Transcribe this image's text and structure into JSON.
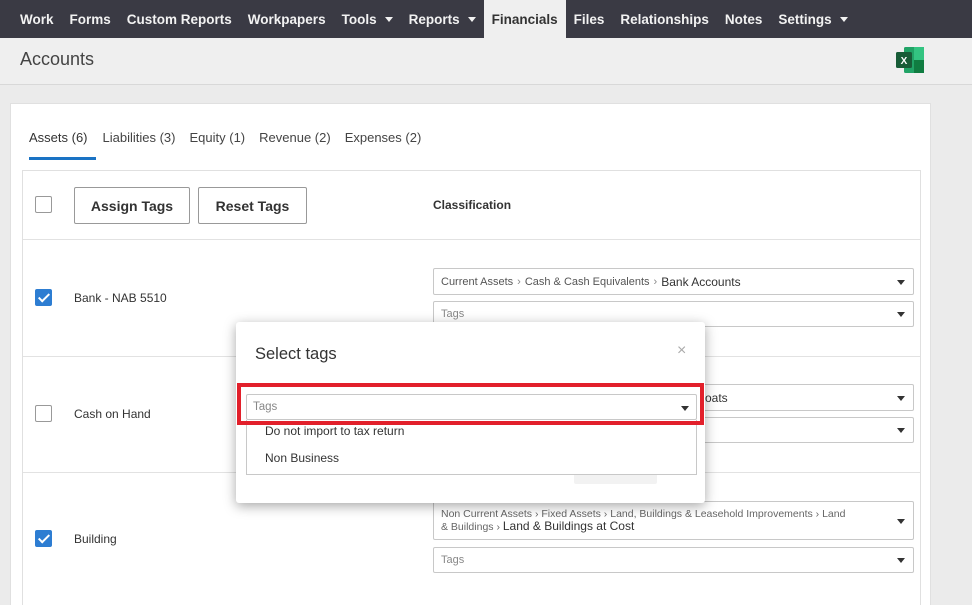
{
  "nav": {
    "items": [
      {
        "label": "Work",
        "caret": false
      },
      {
        "label": "Forms",
        "caret": false
      },
      {
        "label": "Custom Reports",
        "caret": false
      },
      {
        "label": "Workpapers",
        "caret": false
      },
      {
        "label": "Tools",
        "caret": true
      },
      {
        "label": "Reports",
        "caret": true
      },
      {
        "label": "Financials",
        "caret": false,
        "active": true
      },
      {
        "label": "Files",
        "caret": false
      },
      {
        "label": "Relationships",
        "caret": false
      },
      {
        "label": "Notes",
        "caret": false
      },
      {
        "label": "Settings",
        "caret": true
      }
    ]
  },
  "page": {
    "title": "Accounts",
    "export_icon": "excel-icon"
  },
  "tabs": [
    {
      "label": "Assets (6)",
      "active": true
    },
    {
      "label": "Liabilities (3)"
    },
    {
      "label": "Equity (1)"
    },
    {
      "label": "Revenue (2)"
    },
    {
      "label": "Expenses (2)"
    }
  ],
  "table": {
    "assign_tags_label": "Assign Tags",
    "reset_tags_label": "Reset Tags",
    "classification_header": "Classification",
    "rows": [
      {
        "label": "Bank - NAB 5510",
        "checked": true,
        "classification_path": [
          "Current Assets",
          "Cash & Cash Equivalents"
        ],
        "classification_value": "Bank Accounts",
        "tags_placeholder": "Tags"
      },
      {
        "label": "Cash on Hand",
        "checked": false,
        "classification_fragment": "oats"
      },
      {
        "label": "Building",
        "checked": true,
        "classification_path_line1": "Non Current Assets › Fixed Assets › Land, Buildings & Leasehold Improvements › Land",
        "classification_path_line2": "& Buildings ›",
        "classification_value": "Land & Buildings at Cost",
        "tags_placeholder": "Tags"
      }
    ]
  },
  "modal": {
    "title": "Select tags",
    "close_glyph": "×",
    "select_placeholder": "Tags",
    "options": [
      "Do not import to tax return",
      "Non Business"
    ]
  },
  "colors": {
    "nav_bg": "#3a3a44",
    "accent": "#1a73c4",
    "checkbox": "#2d7dd2",
    "highlight": "#e2202b",
    "excel": "#1d7a45"
  }
}
